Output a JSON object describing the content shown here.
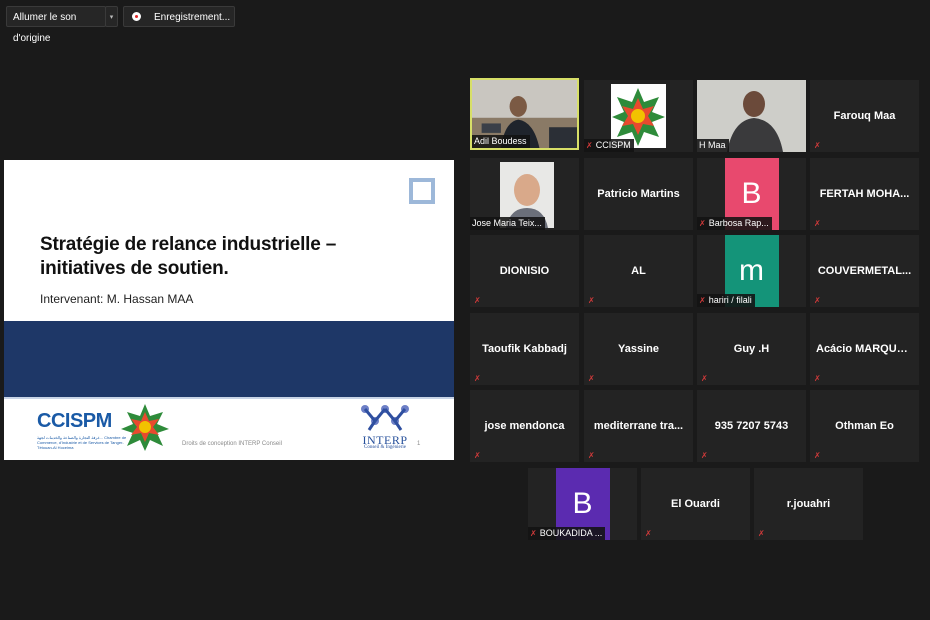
{
  "toolbar": {
    "original_sound_label": "Allumer le son d'origine",
    "dropdown_glyph": "▾",
    "recording_label": "Enregistrement..."
  },
  "slide": {
    "title": "Stratégie de relance industrielle – initiatives de soutien.",
    "subtitle": "Intervenant: M. Hassan MAA",
    "left_logo": "CCISPM",
    "left_logo_caption": "غرفة التجارة والصناعة والخدمات لجهة... Chambre de Commerce, d'Industrie et de Services de Tanger-Tétouan-Al Hoceima",
    "credit": "Droits de conception INTERP Conseil",
    "right_logo": "INTERP",
    "right_logo_caption": "Conseil & Ingénierie",
    "page_number": "1",
    "band_color": "#1e3767"
  },
  "participants": [
    {
      "name": "Adil Boudess",
      "kind": "video",
      "active": true
    },
    {
      "name": "CCISPM",
      "kind": "logo"
    },
    {
      "name": "H Maa",
      "kind": "video"
    },
    {
      "name": "Farouq Maa",
      "kind": "name"
    },
    {
      "name": "Jose Maria Teix...",
      "kind": "video"
    },
    {
      "name": "Patricio Martins",
      "kind": "name"
    },
    {
      "name": "Barbosa Rap...",
      "kind": "avatar",
      "letter": "B",
      "color": "#e8496e"
    },
    {
      "name": "FERTAH MOHA...",
      "kind": "name"
    },
    {
      "name": "DIONISIO",
      "kind": "name"
    },
    {
      "name": "AL",
      "kind": "name"
    },
    {
      "name": "hariri / filali",
      "kind": "avatar",
      "letter": "m",
      "color": "#149479"
    },
    {
      "name": "COUVERMETAL...",
      "kind": "name"
    },
    {
      "name": "Taoufik Kabbadj",
      "kind": "name"
    },
    {
      "name": "Yassine",
      "kind": "name"
    },
    {
      "name": "Guy .H",
      "kind": "name"
    },
    {
      "name": "Acácio MARQUE...",
      "kind": "name"
    },
    {
      "name": "jose mendonca",
      "kind": "name"
    },
    {
      "name": "mediterrane tra...",
      "kind": "name"
    },
    {
      "name": "935 7207 5743",
      "kind": "name"
    },
    {
      "name": "Othman Eo",
      "kind": "name"
    },
    {
      "name": "BOUKADIDA ...",
      "kind": "avatar",
      "letter": "B",
      "color": "#5b2bb0"
    },
    {
      "name": "El Ouardi",
      "kind": "name"
    },
    {
      "name": "r.jouahri",
      "kind": "name"
    }
  ],
  "icons": {
    "muted_mic": "muted-mic-icon",
    "recording": "recording-dot-icon",
    "muted_color": "#d23a3a",
    "active_speaker_color": "#d7df68"
  }
}
